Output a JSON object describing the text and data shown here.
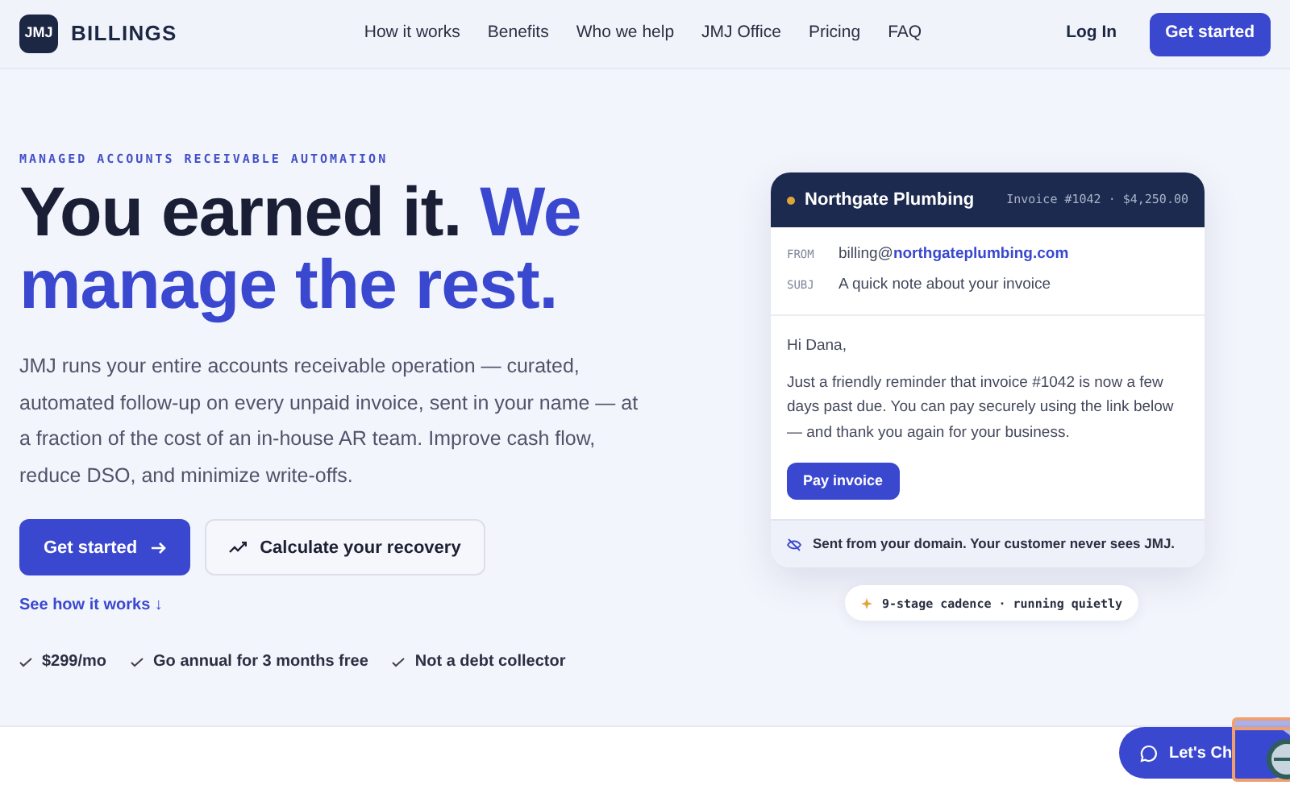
{
  "nav": {
    "logo_mark": "JMJ",
    "brand": "BILLINGS",
    "links": [
      "How it works",
      "Benefits",
      "Who we help",
      "JMJ Office",
      "Pricing",
      "FAQ"
    ],
    "login": "Log In",
    "cta": "Get started"
  },
  "hero": {
    "eyebrow": "MANAGED ACCOUNTS RECEIVABLE AUTOMATION",
    "headline_lead": "You earned it.",
    "headline_accent": "We manage the rest.",
    "body": "JMJ runs your entire accounts receivable operation — curated, automated follow-up on every unpaid invoice, sent in your name — at a fraction of the cost of an in-house AR team. Improve cash flow, reduce DSO, and minimize write-offs.",
    "primary_button": "Get started",
    "secondary_button": "Calculate your recovery",
    "link": "See how it works ↓",
    "checks": [
      "$299/mo",
      "Go annual for 3 months free",
      "Not a debt collector"
    ]
  },
  "email": {
    "company": "Northgate Plumbing",
    "color": "#e0a53a",
    "invoice": "Invoice #1042 · $4,250.00",
    "from_label": "FROM",
    "from": "billing@**northgateplumbing.com**",
    "subj_label": "SUBJ",
    "subject": "A quick note about your invoice",
    "greeting": "Hi Dana,",
    "message": "Just a friendly reminder that invoice #1042 is now a few days past due. You can pay securely using the link below — and thank you again for your business.",
    "button": "Pay invoice",
    "footer": "Sent from your domain. Your customer never sees JMJ."
  },
  "cadence_pill": "9-stage cadence · running quietly",
  "chat_button": "Let's Ch"
}
